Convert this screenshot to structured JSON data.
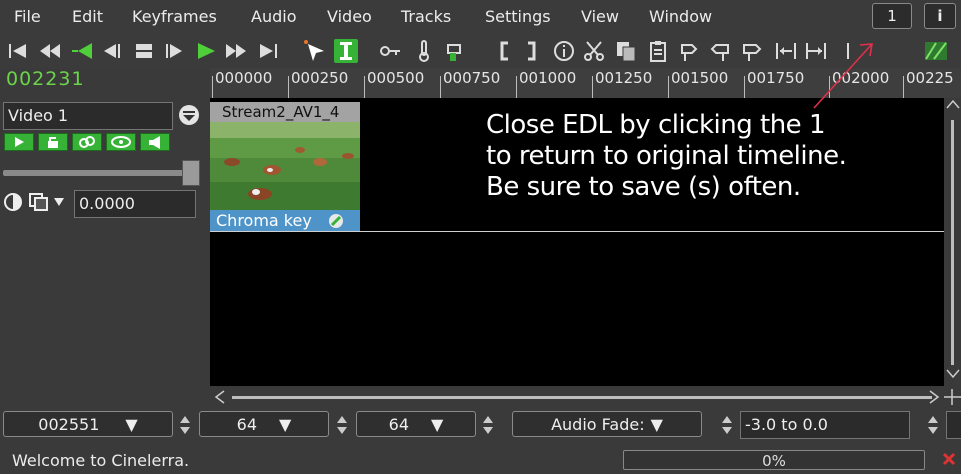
{
  "menu": {
    "items": [
      "File",
      "Edit",
      "Keyframes",
      "Audio",
      "Video",
      "Tracks",
      "Settings",
      "View",
      "Window"
    ],
    "edl_button_label": "1",
    "info_button_label": "i"
  },
  "toolbar": {
    "icons": [
      "goto-start-icon",
      "fast-rewind-icon",
      "rewind-icon",
      "frame-back-icon",
      "stop-icon",
      "frame-forward-icon",
      "play-icon",
      "fast-forward-icon",
      "goto-end-icon",
      "arrow-select-icon",
      "cut-mode-icon",
      "key-icon",
      "thermometer-icon",
      "label-hand-icon",
      "in-point-icon",
      "out-point-icon",
      "info-circle-icon",
      "scissors-icon",
      "copy-icon",
      "paste-icon",
      "label-icon",
      "prev-label-icon",
      "next-label-icon",
      "fit-selection-icon",
      "fit-autos-icon",
      "mixer-icon"
    ],
    "accent_color": "#4fcf3a"
  },
  "timeline": {
    "current_position": "002231",
    "ruler_labels": [
      "000000",
      "000250",
      "000500",
      "000750",
      "001000",
      "001250",
      "001500",
      "001750",
      "002000",
      "00225"
    ]
  },
  "track": {
    "name": "Video 1",
    "fader_value": "0.0000",
    "buttons": [
      "play-track-icon",
      "lock-icon",
      "link-icon",
      "eye-icon",
      "mute-icon"
    ]
  },
  "clip": {
    "title": "Stream2_AV1_4",
    "effect": "Chroma key",
    "effect_color": "#4f94c8"
  },
  "annotation": {
    "lines": [
      "Close EDL by clicking the 1",
      "to return to original timeline.",
      "Be sure to save (s) often."
    ],
    "arrow_color": "#e0304a"
  },
  "bottom": {
    "position_value": "002551",
    "zoom_value": "64",
    "track_zoom_value": "64",
    "fade_mode": "Audio Fade:",
    "fade_range": "-3.0 to 0.0"
  },
  "status": {
    "message": "Welcome to Cinelerra.",
    "progress_label": "0%"
  }
}
